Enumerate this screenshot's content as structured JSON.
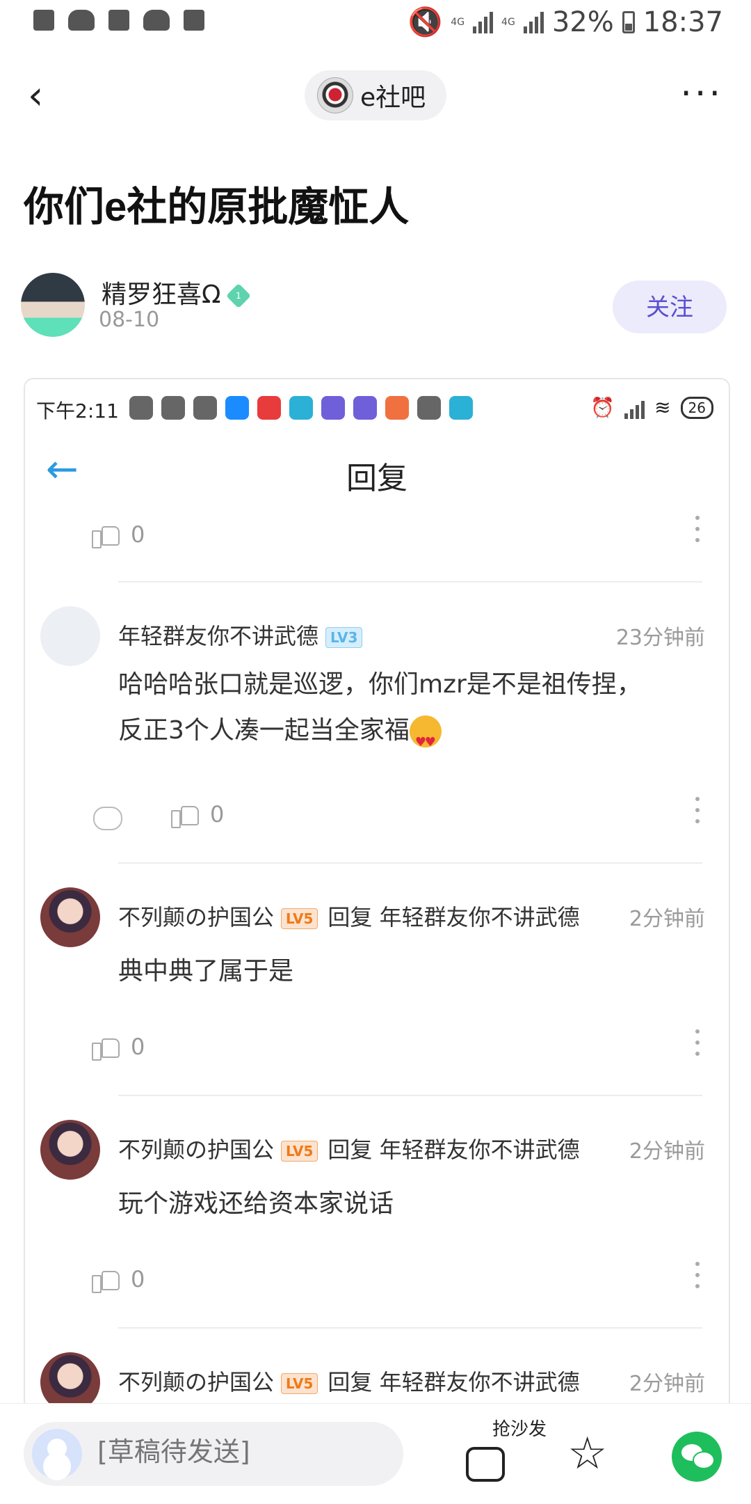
{
  "status_bar": {
    "battery_percent": "32%",
    "time": "18:37"
  },
  "app_bar": {
    "back_icon": "chevron-left-icon",
    "forum_name": "e社吧",
    "more_icon": "more-horizontal-icon"
  },
  "post": {
    "title": "你们e社的原批魔怔人",
    "author": {
      "name": "精罗狂喜Ω",
      "badge_level": "1",
      "date": "08-10"
    },
    "follow_label": "关注"
  },
  "screenshot": {
    "status_bar": {
      "time": "下午2:11",
      "battery": "26"
    },
    "header": {
      "title": "回复"
    },
    "top_like_count": "0",
    "comments": [
      {
        "user": "年轻群友你不讲武德",
        "level": "LV3",
        "reply_label": "",
        "reply_to": "",
        "time": "23分钟前",
        "text_line1": "哈哈哈张口就是巡逻，你们mzr是不是祖传捏，",
        "text_line2": "反正3个人凑一起当全家福",
        "likes": "0"
      },
      {
        "user": "不列颠の护国公",
        "level": "LV5",
        "reply_label": "回复",
        "reply_to": "年轻群友你不讲武德",
        "time": "2分钟前",
        "text": "典中典了属于是",
        "likes": "0"
      },
      {
        "user": "不列颠の护国公",
        "level": "LV5",
        "reply_label": "回复",
        "reply_to": "年轻群友你不讲武德",
        "time": "2分钟前",
        "text": "玩个游戏还给资本家说话",
        "likes": "0"
      },
      {
        "user": "不列颠の护国公",
        "level": "LV5",
        "reply_label": "回复",
        "reply_to": "年轻群友你不讲武德",
        "time": "2分钟前"
      }
    ]
  },
  "bottom_bar": {
    "input_placeholder": "[草稿待发送]",
    "sofa_label": "抢沙发"
  }
}
